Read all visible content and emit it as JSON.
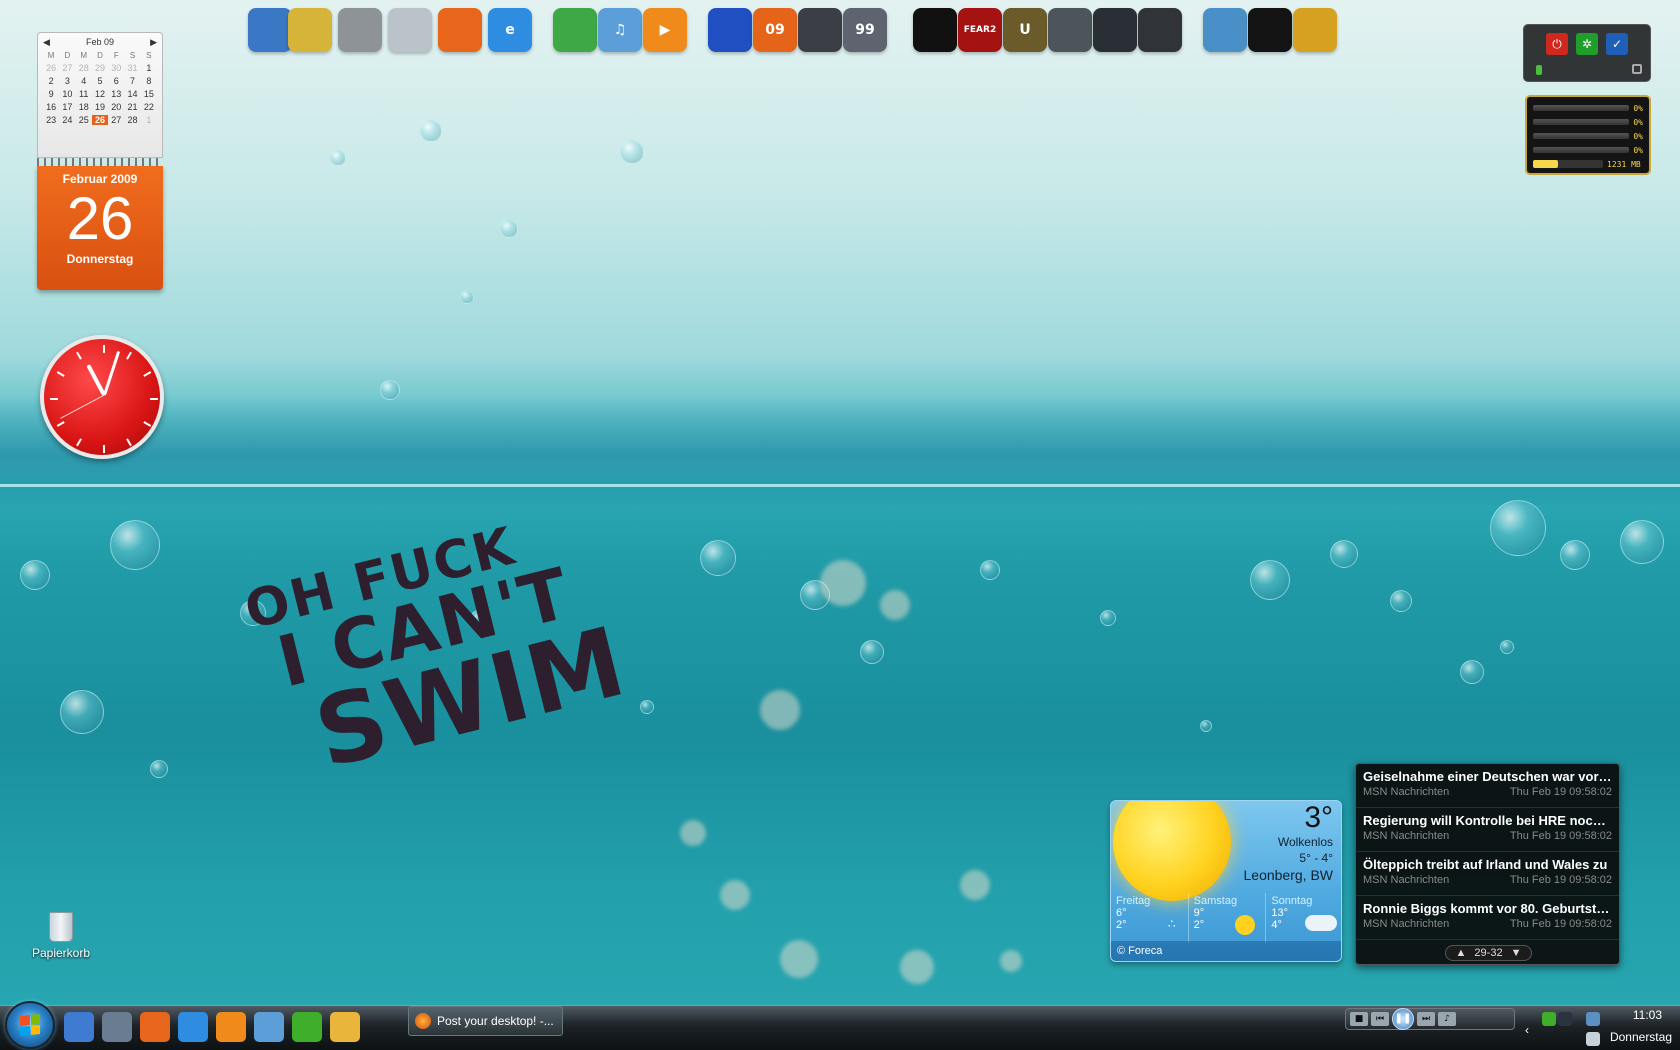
{
  "wallpaper": {
    "lines": [
      "OH FUCK",
      "I CAN'T",
      "SWIM"
    ]
  },
  "dock": {
    "icons": [
      {
        "name": "computer-icon",
        "color": "#3a78c5",
        "label": ""
      },
      {
        "name": "documents-icon",
        "color": "#d6b43a",
        "label": ""
      },
      {
        "name": "tools-icon",
        "color": "#8d9396",
        "label": ""
      },
      {
        "name": "recycle-bin-icon",
        "color": "#b9c3c9",
        "label": ""
      },
      {
        "name": "firefox-icon",
        "color": "#e8661c",
        "label": ""
      },
      {
        "name": "internet-explorer-icon",
        "color": "#2e8de0",
        "label": "e"
      },
      {
        "name": "windows-icon",
        "color": "#3ea845",
        "label": ""
      },
      {
        "name": "itunes-icon",
        "color": "#5c9fd8",
        "label": "♫"
      },
      {
        "name": "media-player-icon",
        "color": "#f08b1b",
        "label": "▶"
      },
      {
        "name": "save-icon",
        "color": "#1f4fc0",
        "label": ""
      },
      {
        "name": "nero-icon",
        "color": "#e6641a",
        "label": "09"
      },
      {
        "name": "headset-icon",
        "color": "#3b3f45",
        "label": ""
      },
      {
        "name": "monitor-icon",
        "color": "#5d6470",
        "label": "99"
      },
      {
        "name": "steam-icon",
        "color": "#111111",
        "label": ""
      },
      {
        "name": "fear2-icon",
        "color": "#a41212",
        "label": "FEAR2"
      },
      {
        "name": "unreal-icon",
        "color": "#6b5a2a",
        "label": "U"
      },
      {
        "name": "crysis-icon",
        "color": "#4d555c",
        "label": ""
      },
      {
        "name": "game-launcher-icon",
        "color": "#2a2f36",
        "label": ""
      },
      {
        "name": "eagle-icon",
        "color": "#303338",
        "label": ""
      },
      {
        "name": "globe-icon",
        "color": "#4a90c8",
        "label": ""
      },
      {
        "name": "shirt-icon",
        "color": "#141414",
        "label": ""
      },
      {
        "name": "hammer-icon",
        "color": "#d6a120",
        "label": ""
      }
    ]
  },
  "calendar": {
    "header": "Feb 09",
    "weekdays": [
      "M",
      "D",
      "M",
      "D",
      "F",
      "S",
      "S"
    ],
    "days": [
      [
        "26",
        "27",
        "28",
        "29",
        "30",
        "31",
        "1"
      ],
      [
        "2",
        "3",
        "4",
        "5",
        "6",
        "7",
        "8"
      ],
      [
        "9",
        "10",
        "11",
        "12",
        "13",
        "14",
        "15"
      ],
      [
        "16",
        "17",
        "18",
        "19",
        "20",
        "21",
        "22"
      ],
      [
        "23",
        "24",
        "25",
        "26",
        "27",
        "28",
        "1"
      ]
    ],
    "today": "26",
    "month_year": "Februar 2009",
    "day_number": "26",
    "weekday": "Donnerstag"
  },
  "desktop": {
    "recycle_bin_label": "Papierkorb"
  },
  "system_monitor": {
    "cores": [
      "0%",
      "0%",
      "0%",
      "0%"
    ],
    "memory": "1231 MB",
    "memory_fraction": 0.35
  },
  "weather": {
    "temperature": "3°",
    "condition": "Wolkenlos",
    "range": "5° - 4°",
    "location": "Leonberg, BW",
    "forecast": [
      {
        "day": "Freitag",
        "high": "6°",
        "low": "2°",
        "icon": "snow-icon"
      },
      {
        "day": "Samstag",
        "high": "9°",
        "low": "2°",
        "icon": "sun-icon"
      },
      {
        "day": "Sonntag",
        "high": "13°",
        "low": "4°",
        "icon": "cloud-icon"
      }
    ],
    "credit": "© Foreca"
  },
  "news": {
    "items": [
      {
        "title": "Geiselnahme einer Deutschen war vorge...",
        "source": "MSN Nachrichten",
        "date": "Thu Feb 19 09:58:02"
      },
      {
        "title": "Regierung will Kontrolle bei HRE noch im...",
        "source": "MSN Nachrichten",
        "date": "Thu Feb 19 09:58:02"
      },
      {
        "title": "Ölteppich treibt auf Irland und Wales zu",
        "source": "MSN Nachrichten",
        "date": "Thu Feb 19 09:58:02"
      },
      {
        "title": "Ronnie Biggs kommt vor 80. Geburtstag ...",
        "source": "MSN Nachrichten",
        "date": "Thu Feb 19 09:58:02"
      }
    ],
    "pager": "29-32"
  },
  "taskbar": {
    "quick_launch": [
      {
        "name": "show-desktop-icon",
        "color": "#3f7bd0"
      },
      {
        "name": "switch-windows-icon",
        "color": "#6a7c92"
      },
      {
        "name": "firefox-icon",
        "color": "#e8661c"
      },
      {
        "name": "internet-explorer-icon",
        "color": "#2e8de0"
      },
      {
        "name": "media-player-icon",
        "color": "#f08b1b"
      },
      {
        "name": "itunes-icon",
        "color": "#5c9fd8"
      },
      {
        "name": "icq-icon",
        "color": "#3fae2a"
      },
      {
        "name": "mail-icon",
        "color": "#e9b53b"
      }
    ],
    "active_window": "Post your desktop! -...",
    "time": "11:03",
    "day": "Donnerstag"
  }
}
